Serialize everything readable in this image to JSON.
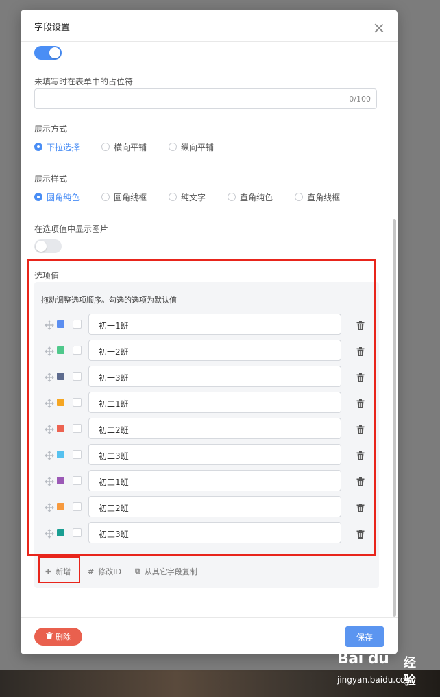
{
  "modal": {
    "title": "字段设置",
    "placeholder_label": "未填写时在表单中的占位符",
    "placeholder_counter": "0/100",
    "display_mode": {
      "label": "展示方式",
      "options": [
        "下拉选择",
        "横向平铺",
        "纵向平铺"
      ],
      "selected": "下拉选择"
    },
    "display_style": {
      "label": "展示样式",
      "options": [
        "圆角纯色",
        "圆角线框",
        "纯文字",
        "直角纯色",
        "直角线框"
      ],
      "selected": "圆角纯色"
    },
    "show_image_label": "在选项值中显示图片",
    "toggles": {
      "top_enabled": true,
      "show_image": false
    },
    "options_section": {
      "label": "选项值",
      "hint": "拖动调整选项顺序。勾选的选项为默认值",
      "items": [
        {
          "text": "初一1班",
          "color": "#5b8ef0"
        },
        {
          "text": "初一2班",
          "color": "#4fc88b"
        },
        {
          "text": "初一3班",
          "color": "#5d6b8e"
        },
        {
          "text": "初二1班",
          "color": "#f5a623"
        },
        {
          "text": "初二2班",
          "color": "#ec6351"
        },
        {
          "text": "初二3班",
          "color": "#56c1ef"
        },
        {
          "text": "初三1班",
          "color": "#9b59b6"
        },
        {
          "text": "初三2班",
          "color": "#f79a3e"
        },
        {
          "text": "初三3班",
          "color": "#1a9e92"
        }
      ],
      "actions": {
        "add": "新增",
        "edit_id": "修改ID",
        "copy_from": "从其它字段复制"
      }
    },
    "footer": {
      "delete_label": "删除",
      "save_label": "保存"
    }
  },
  "watermark": {
    "logo": "Bai du",
    "brand": "经验",
    "url": "jingyan.baidu.com"
  },
  "colors": {
    "accent": "#4a8ef5",
    "danger": "#e9604e",
    "highlight": "#e8251b"
  }
}
